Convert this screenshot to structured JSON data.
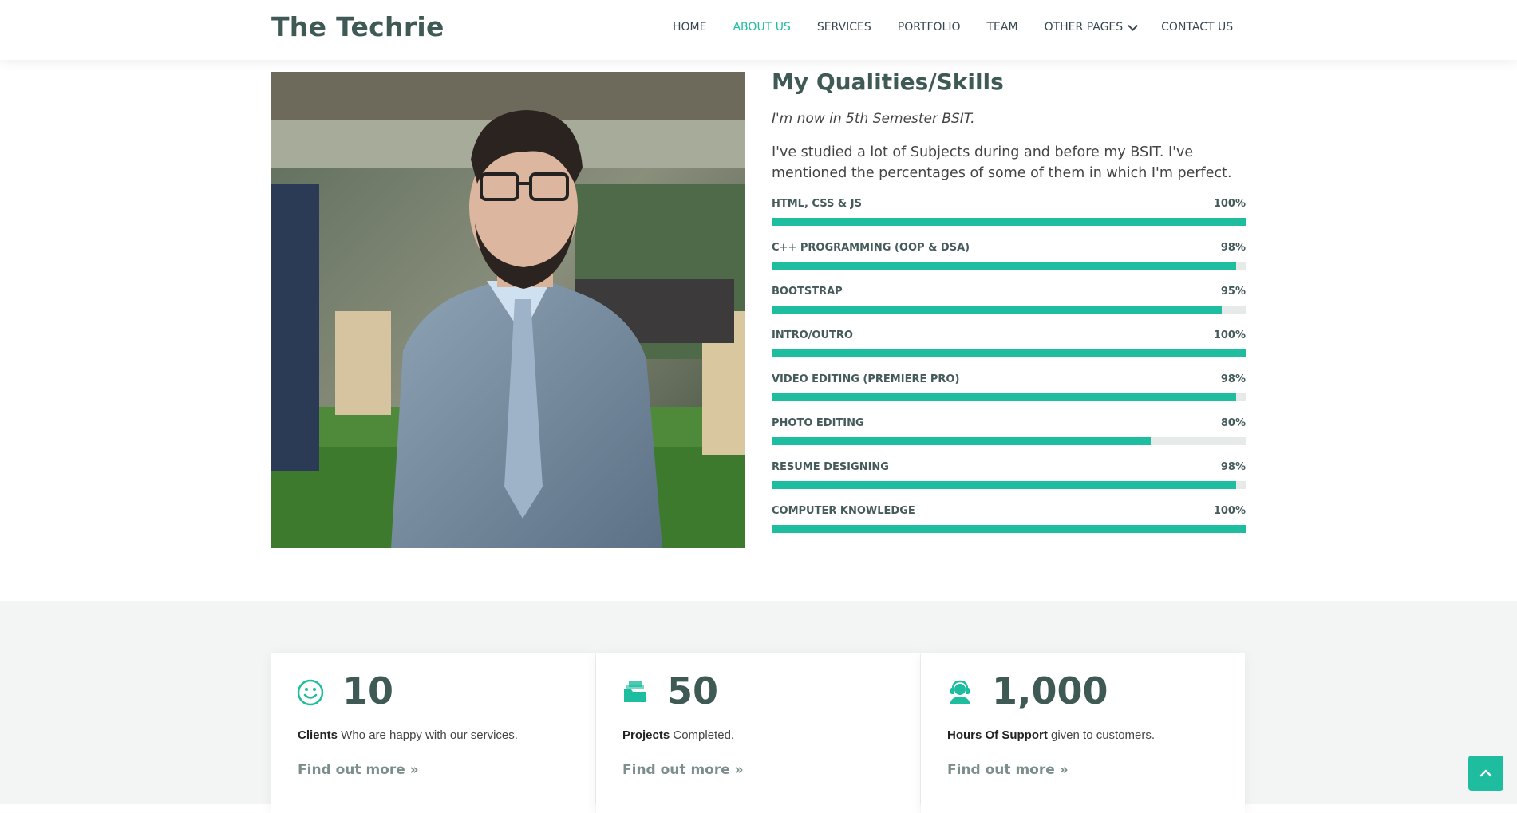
{
  "header": {
    "logo": "The Techrie",
    "nav": [
      {
        "label": "HOME",
        "active": false
      },
      {
        "label": "ABOUT US",
        "active": true
      },
      {
        "label": "SERVICES",
        "active": false
      },
      {
        "label": "PORTFOLIO",
        "active": false
      },
      {
        "label": "TEAM",
        "active": false
      },
      {
        "label": "OTHER PAGES",
        "active": false,
        "dropdown": true
      },
      {
        "label": "CONTACT US",
        "active": false
      }
    ]
  },
  "skills_section": {
    "title_light": "My",
    "title_bold": "Qualities/Skills",
    "subtitle": "I'm now in 5th Semester BSIT.",
    "description": "I've studied a lot of Subjects during and before my BSIT. I've mentioned the percentages of some of them in which I'm perfect.",
    "skills": [
      {
        "name": "HTML, CSS & JS",
        "percent_label": "100%",
        "value": 100
      },
      {
        "name": "C++ PROGRAMMING (OOP & DSA)",
        "percent_label": "98%",
        "value": 98
      },
      {
        "name": "BOOTSTRAP",
        "percent_label": "95%",
        "value": 95
      },
      {
        "name": "INTRO/OUTRO",
        "percent_label": "100%",
        "value": 100
      },
      {
        "name": "VIDEO EDITING (PREMIERE PRO)",
        "percent_label": "98%",
        "value": 98
      },
      {
        "name": "PHOTO EDITING",
        "percent_label": "80%",
        "value": 80
      },
      {
        "name": "RESUME DESIGNING",
        "percent_label": "98%",
        "value": 98
      },
      {
        "name": "COMPUTER KNOWLEDGE",
        "percent_label": "100%",
        "value": 100
      }
    ]
  },
  "stats": [
    {
      "icon": "smile-icon",
      "number": "10",
      "bold": "Clients",
      "text": " Who are happy with our services.",
      "link": "Find out more »"
    },
    {
      "icon": "folder-icon",
      "number": "50",
      "bold": "Projects",
      "text": " Completed.",
      "link": "Find out more »"
    },
    {
      "icon": "support-agent-icon",
      "number": "1,000",
      "bold": "Hours Of Support",
      "text": " given to customers.",
      "link": "Find out more »"
    }
  ],
  "colors": {
    "accent": "#1ebd9f",
    "heading": "#3f5a55",
    "track": "#e6eae9",
    "section_bg": "#f3f5f5"
  },
  "back_to_top": {
    "icon": "chevron-up-icon"
  }
}
